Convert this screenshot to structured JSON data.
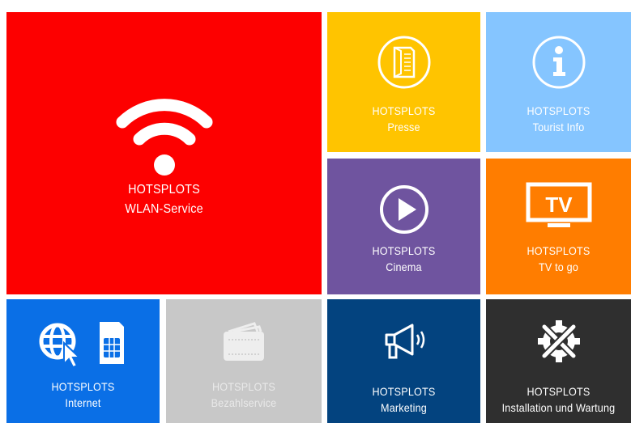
{
  "tiles": {
    "wlan": {
      "line1": "HOTSPLOTS",
      "line2": "WLAN-Service",
      "icon": "wifi-icon",
      "color": "#fd0000"
    },
    "presse": {
      "line1": "HOTSPLOTS",
      "line2": "Presse",
      "icon": "newspaper-icon",
      "color": "#ffc400"
    },
    "tourist": {
      "line1": "HOTSPLOTS",
      "line2": "Tourist Info",
      "icon": "info-icon",
      "color": "#85c5ff"
    },
    "cinema": {
      "line1": "HOTSPLOTS",
      "line2": "Cinema",
      "icon": "play-icon",
      "color": "#6f549f"
    },
    "tv": {
      "line1": "HOTSPLOTS",
      "line2": "TV to go",
      "icon": "tv-icon",
      "color": "#ff7d00"
    },
    "internet": {
      "line1": "HOTSPLOTS",
      "line2": "Internet",
      "icon": "globe-sim-icon",
      "color": "#0a6fe6"
    },
    "bezahl": {
      "line1": "HOTSPLOTS",
      "line2": "Bezahlservice",
      "icon": "wallet-icon",
      "color": "#c8c8c8"
    },
    "marketing": {
      "line1": "HOTSPLOTS",
      "line2": "Marketing",
      "icon": "megaphone-icon",
      "color": "#03437f"
    },
    "install": {
      "line1": "HOTSPLOTS",
      "line2": "Installation und Wartung",
      "icon": "tools-gear-icon",
      "color": "#2f2f2f"
    }
  }
}
